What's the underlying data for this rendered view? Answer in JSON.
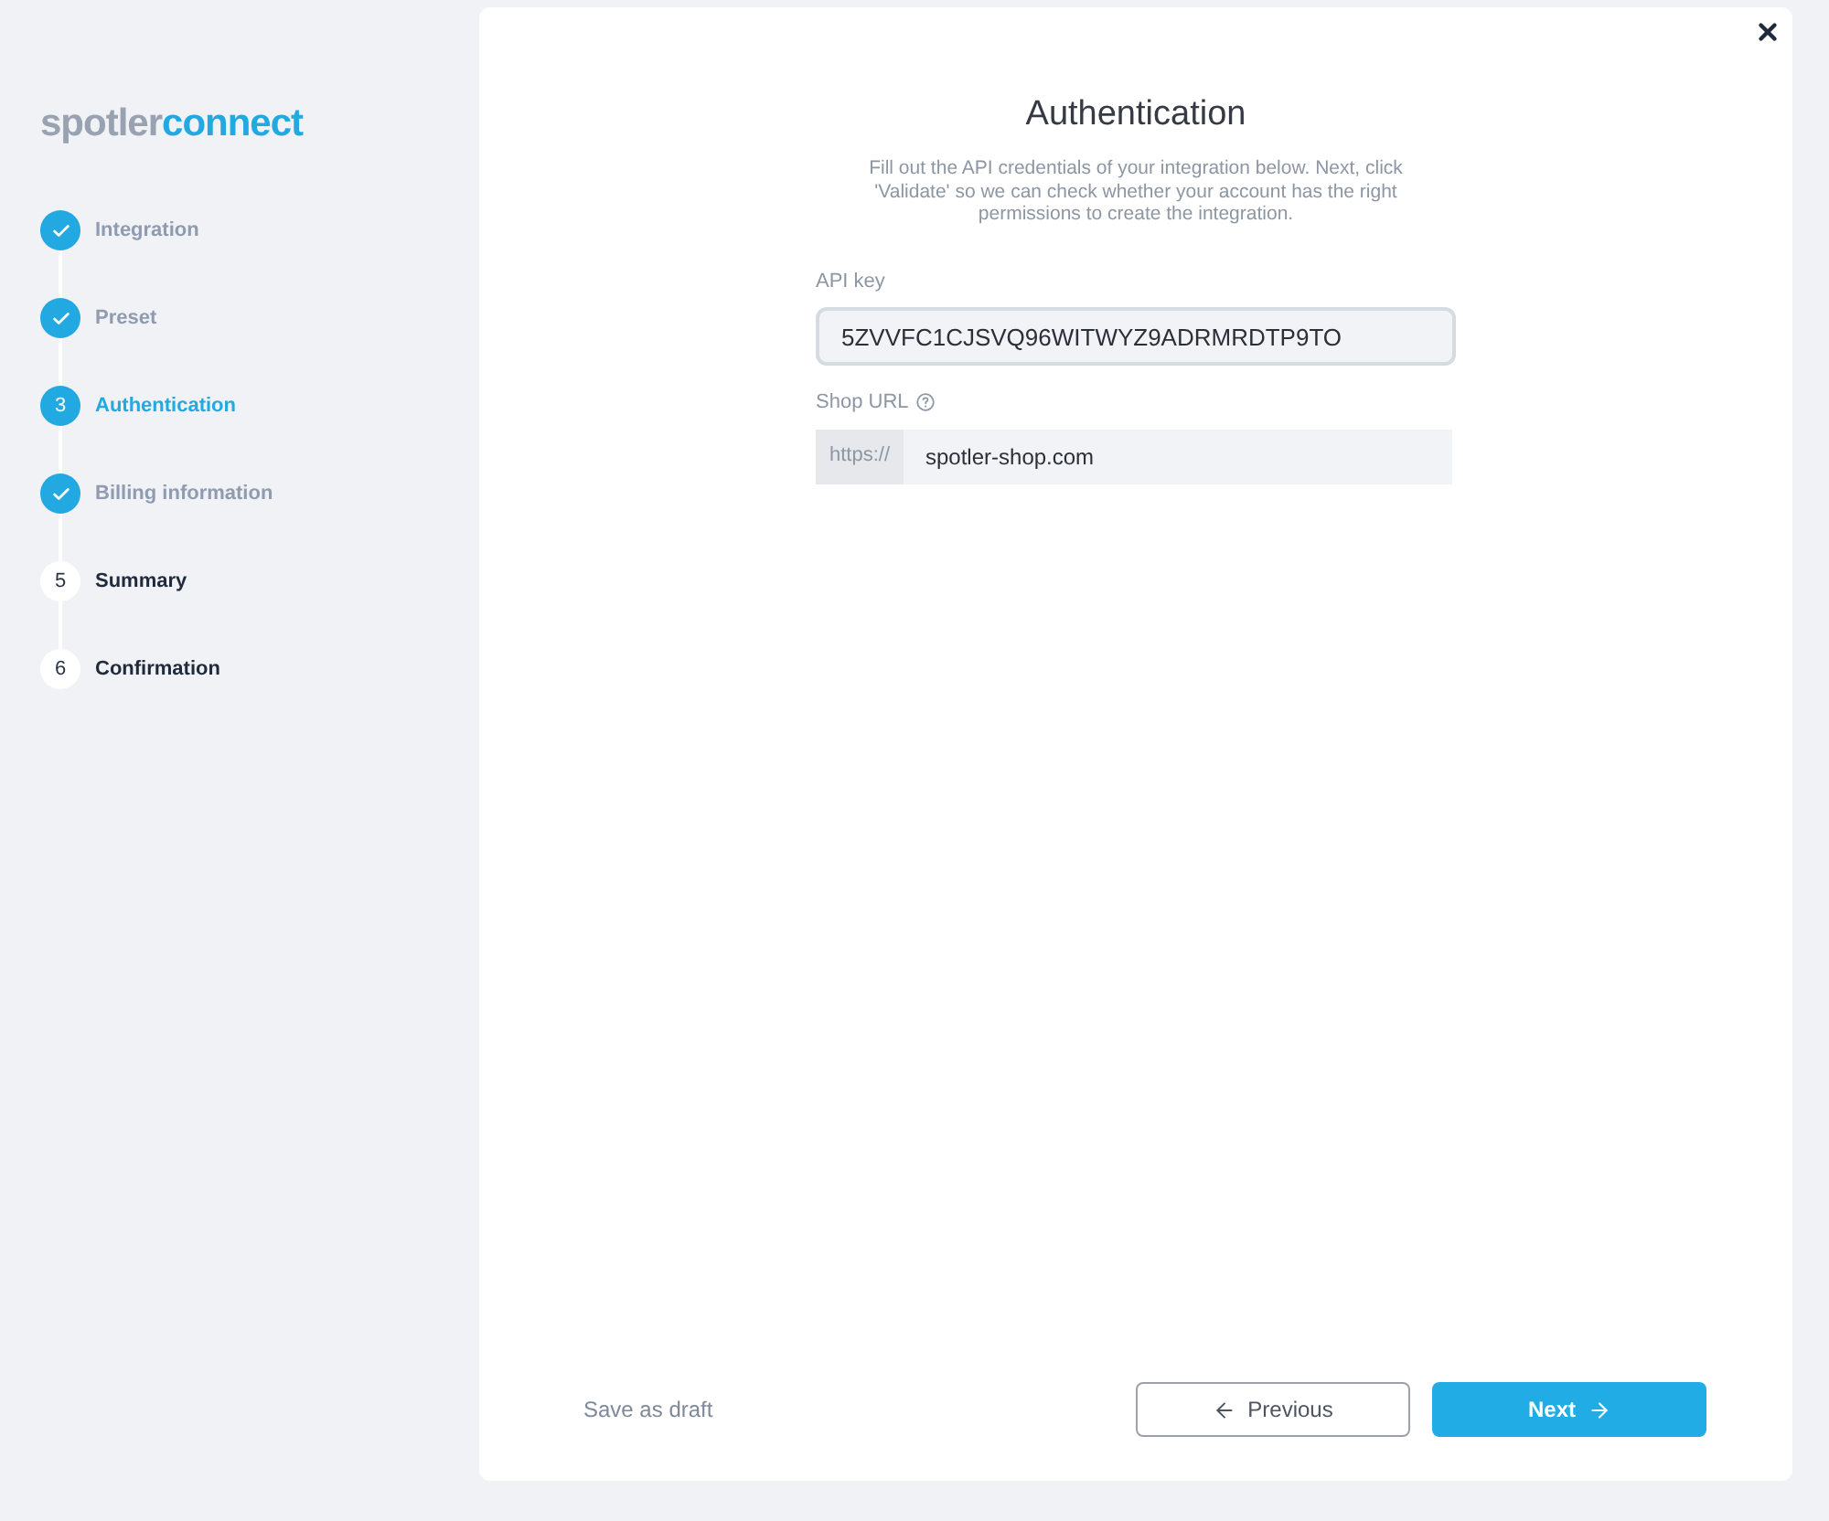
{
  "logo": {
    "part_1": "spotler",
    "part_2": "connect"
  },
  "steps": [
    {
      "label": "Integration",
      "completed": true,
      "selected": false
    },
    {
      "label": "Preset",
      "completed": true,
      "selected": false
    },
    {
      "number": "3",
      "label": "Authentication",
      "completed": false,
      "selected": true
    },
    {
      "label": "Billing information",
      "completed": true,
      "selected": false
    },
    {
      "number": "5",
      "label": "Summary",
      "completed": false,
      "selected": false
    },
    {
      "number": "6",
      "label": "Confirmation",
      "completed": false,
      "selected": false
    }
  ],
  "dialog": {
    "title": "Authentication",
    "description": "Fill out the API credentials of your integration below. Next, click 'Validate' so we can check whether your account has the right permissions to create the integration."
  },
  "fields": [
    {
      "kind": "text",
      "label": "API key",
      "value": "5ZVVFC1CJSVQ96WITWYZ9ADRMRDTP9TO",
      "focused": true
    },
    {
      "kind": "prefixed",
      "label": "Shop URL",
      "help": true,
      "prefix": "https://",
      "value": "spotler-shop.com",
      "focused": false
    }
  ],
  "footer": {
    "draft": "Save as draft",
    "previous": "Previous",
    "next": "Next"
  }
}
